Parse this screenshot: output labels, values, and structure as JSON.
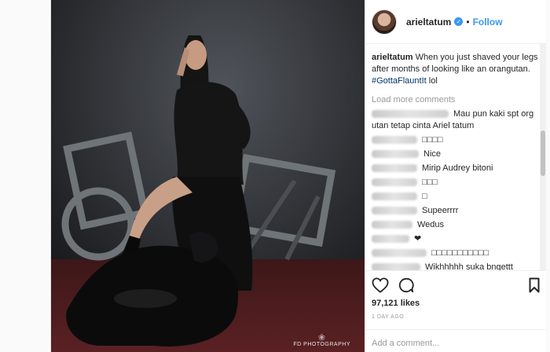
{
  "post": {
    "username": "arieltatum",
    "follow_label": "Follow",
    "verified_icon": "verified-badge-icon",
    "caption": {
      "username": "arieltatum",
      "text": "When you just shaved your legs after months of looking like an orangutan.",
      "hashtag": "#GottaFlauntIt",
      "suffix": "lol"
    },
    "load_more": "Load more comments",
    "comments": [
      {
        "text": "Mau pun kaki spt org utan tetap cinta Ariel tatum"
      },
      {
        "text": "□□□□"
      },
      {
        "text": "Nice"
      },
      {
        "text": "Mirip Audrey bitoni"
      },
      {
        "text": "□□□"
      },
      {
        "text": "□"
      },
      {
        "text": "Supeerrrr"
      },
      {
        "text": "Wedus"
      },
      {
        "text": "❤"
      },
      {
        "text": "□□□□□□□□□□□"
      },
      {
        "text": "Wikhhhhh suka bngettt"
      }
    ],
    "likes": "97,121 likes",
    "time_ago": "1 DAY AGO",
    "add_comment_placeholder": "Add a comment...",
    "photo_watermark": "FD PHOTOGRAPHY"
  },
  "colors": {
    "accent": "#3897f0",
    "hashtag": "#003569",
    "muted": "#999999"
  }
}
